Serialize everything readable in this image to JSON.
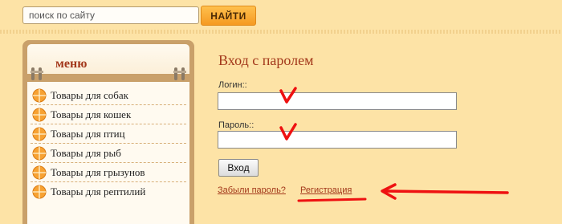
{
  "search": {
    "placeholder_text": "поиск по сайту",
    "button_label": "НАЙТИ"
  },
  "menu": {
    "title": "меню",
    "items": [
      {
        "label": "Товары для собак"
      },
      {
        "label": "Товары для кошек"
      },
      {
        "label": "Товары для птиц"
      },
      {
        "label": "Товары для рыб"
      },
      {
        "label": "Товары для грызунов"
      },
      {
        "label": "Товары для рептилий"
      }
    ]
  },
  "login": {
    "title": "Вход с паролем",
    "login_label": "Логин::",
    "login_value": "",
    "password_label": "Пароль::",
    "password_value": "",
    "submit_label": "Вход",
    "forgot_link": "Забыли пароль?",
    "register_link": "Регистрация"
  },
  "colors": {
    "page_bg": "#fde3a6",
    "accent_red": "#a3381b",
    "button_orange": "#f59a22",
    "annotation_red": "#ee1111"
  },
  "icons": {
    "menu_bullet": "orange-circle-bullet-icon",
    "binder_ring": "binder-ring-icon"
  }
}
